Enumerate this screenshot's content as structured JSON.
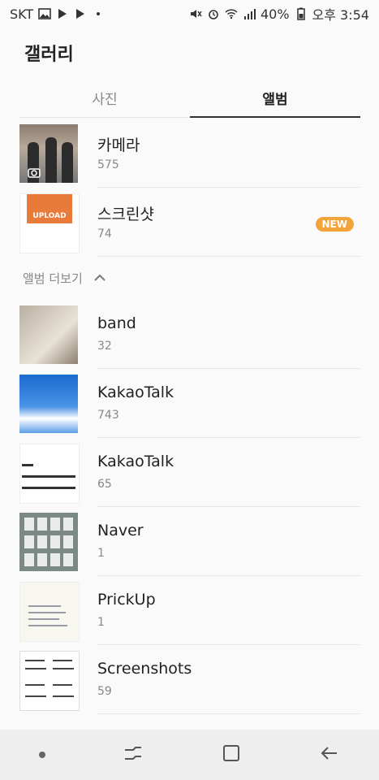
{
  "status": {
    "carrier": "SKT",
    "battery": "40%",
    "time": "오후 3:54"
  },
  "app": {
    "title": "갤러리"
  },
  "tabs": [
    {
      "label": "사진"
    },
    {
      "label": "앨범"
    }
  ],
  "albums": [
    {
      "name": "카메라",
      "count": "575"
    },
    {
      "name": "스크린샷",
      "count": "74",
      "badge": "NEW",
      "thumb_text": "UPLOAD"
    }
  ],
  "more_section": {
    "label": "앨범 더보기"
  },
  "more_albums": [
    {
      "name": "band",
      "count": "32"
    },
    {
      "name": "KakaoTalk",
      "count": "743"
    },
    {
      "name": "KakaoTalk",
      "count": "65"
    },
    {
      "name": "Naver",
      "count": "1"
    },
    {
      "name": "PrickUp",
      "count": "1"
    },
    {
      "name": "Screenshots",
      "count": "59"
    }
  ],
  "colors": {
    "badge": "#f2a43a",
    "accent_line": "#333333",
    "navbar_bg": "#eeeeee"
  }
}
